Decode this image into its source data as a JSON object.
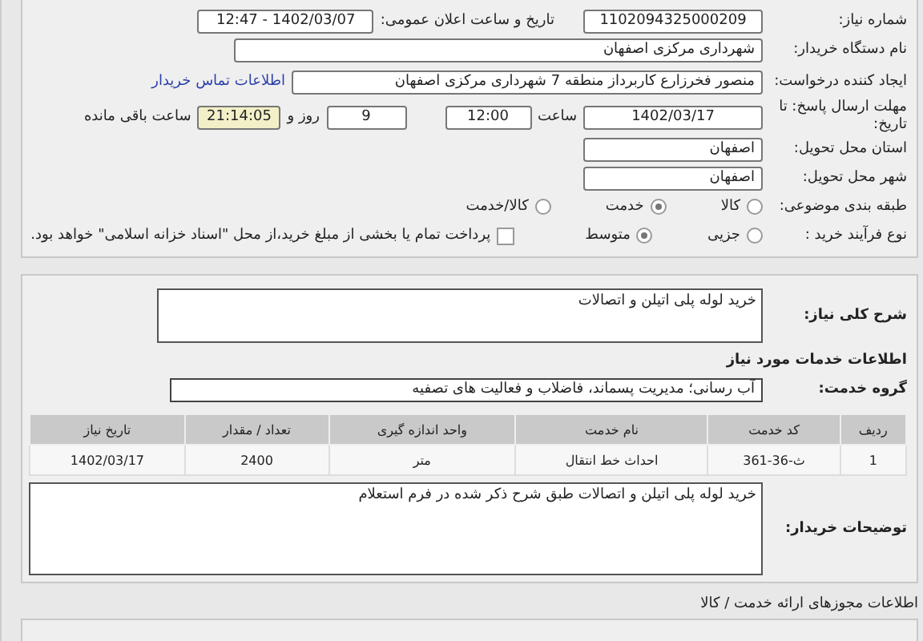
{
  "need_number": {
    "label": "شماره نیاز:",
    "value": "1102094325000209"
  },
  "announce": {
    "label": "تاریخ و ساعت اعلان عمومی:",
    "value": "1402/03/07 - 12:47"
  },
  "buyer": {
    "label": "نام دستگاه خریدار:",
    "value": "شهرداری مرکزی اصفهان"
  },
  "creator": {
    "label": "ایجاد کننده درخواست:",
    "value": "منصور فخرزارع کاربرداز منطقه 7 شهرداری مرکزی اصفهان",
    "link": "اطلاعات تماس خریدار"
  },
  "deadline": {
    "label": "مهلت ارسال پاسخ: تا تاریخ:",
    "date": "1402/03/17",
    "time_label": "ساعت",
    "time": "12:00",
    "days": "9",
    "days_label": "روز و",
    "remaining": "21:14:05",
    "remaining_label": "ساعت باقی مانده"
  },
  "province": {
    "label": "استان محل تحویل:",
    "value": "اصفهان"
  },
  "city": {
    "label": "شهر محل تحویل:",
    "value": "اصفهان"
  },
  "category": {
    "label": "طبقه بندی موضوعی:",
    "options": [
      {
        "label": "کالا",
        "selected": false
      },
      {
        "label": "خدمت",
        "selected": true
      },
      {
        "label": "کالا/خدمت",
        "selected": false
      }
    ]
  },
  "process": {
    "label": "نوع فرآیند خرید :",
    "options": [
      {
        "label": "جزیی",
        "selected": false
      },
      {
        "label": "متوسط",
        "selected": true
      }
    ],
    "treasury": {
      "checked": false,
      "label": "پرداخت تمام یا بخشی از مبلغ خرید،از محل \"اسناد خزانه اسلامی\" خواهد بود."
    }
  },
  "summary": {
    "label": "شرح کلی نیاز:",
    "value": "خرید لوله پلی اتیلن و اتصالات"
  },
  "services_heading": "اطلاعات خدمات مورد نیاز",
  "service_group": {
    "label": "گروه خدمت:",
    "value": "آب رسانی؛ مدیریت پسماند، فاضلاب و فعالیت های تصفیه"
  },
  "table": {
    "columns": [
      "ردیف",
      "کد خدمت",
      "نام خدمت",
      "واحد اندازه گیری",
      "تعداد / مقدار",
      "تاریخ نیاز"
    ],
    "rows": [
      [
        "1",
        "ث-36-361",
        "احداث خط انتقال",
        "متر",
        "2400",
        "1402/03/17"
      ]
    ]
  },
  "buyer_notes": {
    "label": "توضیحات خریدار:",
    "value": "خرید لوله پلی اتیلن و اتصالات طبق شرح ذکر شده در فرم استعلام"
  },
  "permits_heading": "اطلاعات مجوزهای ارائه خدمت / کالا"
}
